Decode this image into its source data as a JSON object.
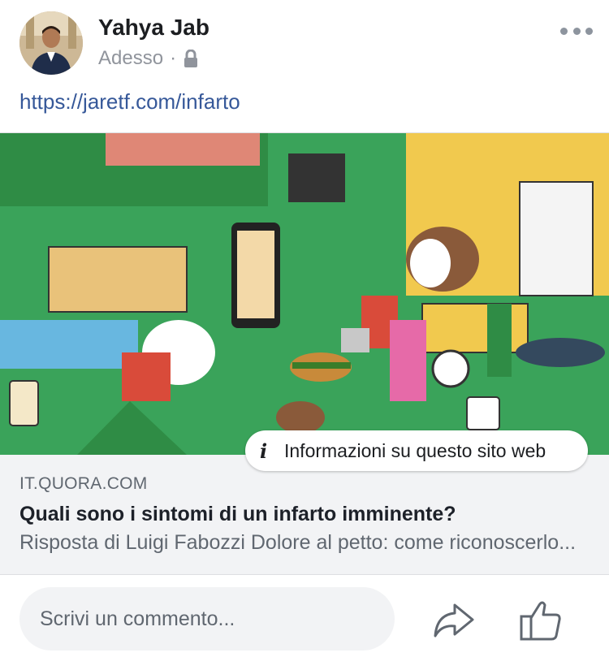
{
  "post": {
    "author": "Yahya Jab",
    "timestamp": "Adesso",
    "separator": "·",
    "privacy_icon": "lock-icon",
    "more_icon": "more-icon",
    "link_text": "https://jaretf.com/infarto"
  },
  "preview": {
    "info_icon": "i",
    "info_label": "Informazioni su questo sito web",
    "domain": "IT.QUORA.COM",
    "title": "Quali sono i sintomi di un infarto imminente?",
    "description": "Risposta di Luigi Fabozzi Dolore al petto: come riconoscerlo..."
  },
  "footer": {
    "comment_placeholder": "Scrivi un commento...",
    "share_icon": "share-icon",
    "like_icon": "like-icon"
  },
  "colors": {
    "link": "#365899",
    "meta": "#90949c",
    "background_gray": "#f2f3f5"
  }
}
